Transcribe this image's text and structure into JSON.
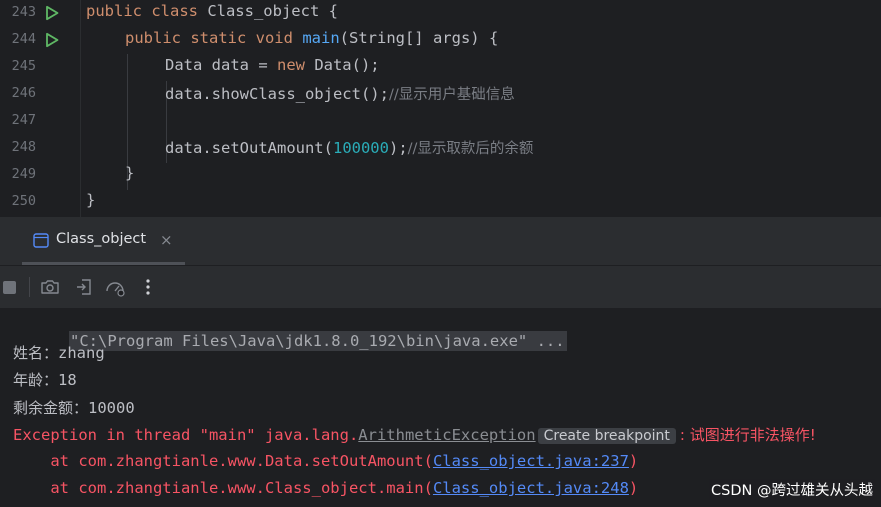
{
  "editor": {
    "lines": [
      {
        "num": "243",
        "run": true
      },
      {
        "num": "244",
        "run": true
      },
      {
        "num": "245",
        "run": false
      },
      {
        "num": "246",
        "run": false
      },
      {
        "num": "247",
        "run": false
      },
      {
        "num": "248",
        "run": false
      },
      {
        "num": "249",
        "run": false
      },
      {
        "num": "250",
        "run": false
      }
    ],
    "code": {
      "l243": {
        "kw": "public class",
        "rest": " Class_object {"
      },
      "l244": {
        "kw1": "public static void",
        "fn": "main",
        "rest": "(String[] args) {"
      },
      "l245": {
        "pre": "Data data = ",
        "kw": "new",
        "rest": " Data();"
      },
      "l246": {
        "pre": "data.showClass_object();",
        "cm": "//显示用户基础信息"
      },
      "l248": {
        "pre": "data.setOutAmount(",
        "num": "100000",
        "post": ");",
        "cm": "//显示取款后的余额"
      },
      "l249": "}",
      "l250": "}"
    }
  },
  "run_tab": {
    "label": "Class_object",
    "close": "×"
  },
  "toolbar": {
    "buttons": [
      "stop-icon",
      "camera-icon",
      "exit-icon",
      "gauge-icon",
      "more-vertical-icon"
    ]
  },
  "console": {
    "cmd": "\"C:\\Program Files\\Java\\jdk1.8.0_192\\bin\\java.exe\" ...",
    "name_label": "姓名：",
    "name_value": "zhang",
    "age_label": "年龄：",
    "age_value": "18",
    "balance_label": "剩余金额：",
    "balance_value": "10000",
    "exception_prefix": "Exception in thread \"main\" java.lang.",
    "exception_class": "ArithmeticException",
    "create_breakpoint": "Create breakpoint",
    "exception_message": ": 试图进行非法操作!",
    "trace1_prefix": "    at com.zhangtianle.www.Data.setOutAmount(",
    "trace1_link": "Class_object.java:237",
    "trace1_suffix": ")",
    "trace2_prefix": "    at com.zhangtianle.www.Class_object.main(",
    "trace2_link": "Class_object.java:248",
    "trace2_suffix": ")"
  },
  "watermark": "CSDN @跨过雄关从头越",
  "colors": {
    "background": "#1e1f22",
    "keyword": "#cf8e6d",
    "function": "#56a8f5",
    "number": "#2aacb8",
    "comment": "#7a7e85",
    "error": "#f75464",
    "link": "#548af7",
    "run_green": "#5fb865"
  }
}
